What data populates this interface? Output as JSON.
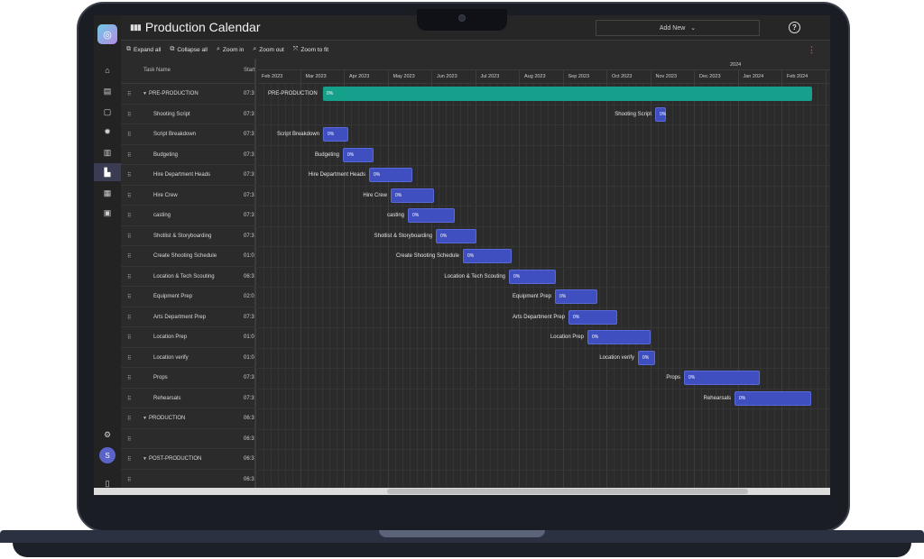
{
  "app": {
    "title": "Production Calendar"
  },
  "topbar": {
    "add_new": "Add New",
    "help": "?"
  },
  "toolbar": {
    "expand_all": "Expand all",
    "collapse_all": "Collapse all",
    "zoom_in": "Zoom in",
    "zoom_out": "Zoom out",
    "zoom_to_fit": "Zoom to fit",
    "more": "⋮"
  },
  "sidebar": {
    "avatar_initial": "S",
    "items": [
      "home-icon",
      "document-icon",
      "clipboard-icon",
      "settings-gear-icon",
      "file-icon",
      "chart-icon",
      "grid-icon",
      "chat-icon"
    ]
  },
  "grid": {
    "col_task_name": "Task Name",
    "col_start": "Start",
    "year_labels": [
      "2024"
    ],
    "months": [
      "Feb 2023",
      "Mar 2023",
      "Apr 2023",
      "May 2023",
      "Jun 2023",
      "Jul 2023",
      "Aug 2023",
      "Sep 2023",
      "Oct 2023",
      "Nov 2023",
      "Dec 2023",
      "Jan 2024",
      "Feb 2024"
    ],
    "rows": [
      {
        "name": "PRE-PRODUCTION",
        "start": "07:3",
        "group": true
      },
      {
        "name": "Shooting Script",
        "start": "07:3"
      },
      {
        "name": "Script Breakdown",
        "start": "07:3"
      },
      {
        "name": "Budgeting",
        "start": "07:3"
      },
      {
        "name": "Hire Department Heads",
        "start": "07:3"
      },
      {
        "name": "Hire Crew",
        "start": "07:3"
      },
      {
        "name": "casting",
        "start": "07:3"
      },
      {
        "name": "Shotlist & Storyboarding",
        "start": "07:3"
      },
      {
        "name": "Create Shooting Schedule",
        "start": "01:0"
      },
      {
        "name": "Location & Tech Scouting",
        "start": "06:3"
      },
      {
        "name": "Equipment Prep",
        "start": "02:0"
      },
      {
        "name": "Arts Department Prep",
        "start": "07:3"
      },
      {
        "name": "Location Prep",
        "start": "01:0"
      },
      {
        "name": "Location verify",
        "start": "01:0"
      },
      {
        "name": "Props",
        "start": "07:3"
      },
      {
        "name": "Rehearsals",
        "start": "07:3"
      },
      {
        "name": "PRODUCTION",
        "start": "06:3",
        "group": true
      },
      {
        "name": "",
        "start": "06:3"
      },
      {
        "name": "POST-PRODUCTION",
        "start": "06:3",
        "group": true
      },
      {
        "name": "",
        "start": "06:3"
      }
    ],
    "bars": [
      {
        "label": "PRE-PRODUCTION",
        "progress": "0%",
        "summary": true
      },
      {
        "label": "Shooting Script",
        "progress": "0%"
      },
      {
        "label": "Script Breakdown",
        "progress": "0%"
      },
      {
        "label": "Budgeting",
        "progress": "0%"
      },
      {
        "label": "Hire Department Heads",
        "progress": "0%"
      },
      {
        "label": "Hire Crew",
        "progress": "0%"
      },
      {
        "label": "casting",
        "progress": "0%"
      },
      {
        "label": "Shotlist & Storyboarding",
        "progress": "0%"
      },
      {
        "label": "Create Shooting Schedule",
        "progress": "0%"
      },
      {
        "label": "Location & Tech Scouting",
        "progress": "0%"
      },
      {
        "label": "Equipment Prep",
        "progress": "0%"
      },
      {
        "label": "Arts Department Prep",
        "progress": "0%"
      },
      {
        "label": "Location Prep",
        "progress": "0%"
      },
      {
        "label": "Location verify",
        "progress": "0%"
      },
      {
        "label": "Props",
        "progress": "0%"
      },
      {
        "label": "Rehearsals",
        "progress": "0%"
      }
    ]
  },
  "colors": {
    "summary_bar": "#15a08c",
    "task_bar": "#3f4fc0",
    "background": "#2b2b2b"
  }
}
